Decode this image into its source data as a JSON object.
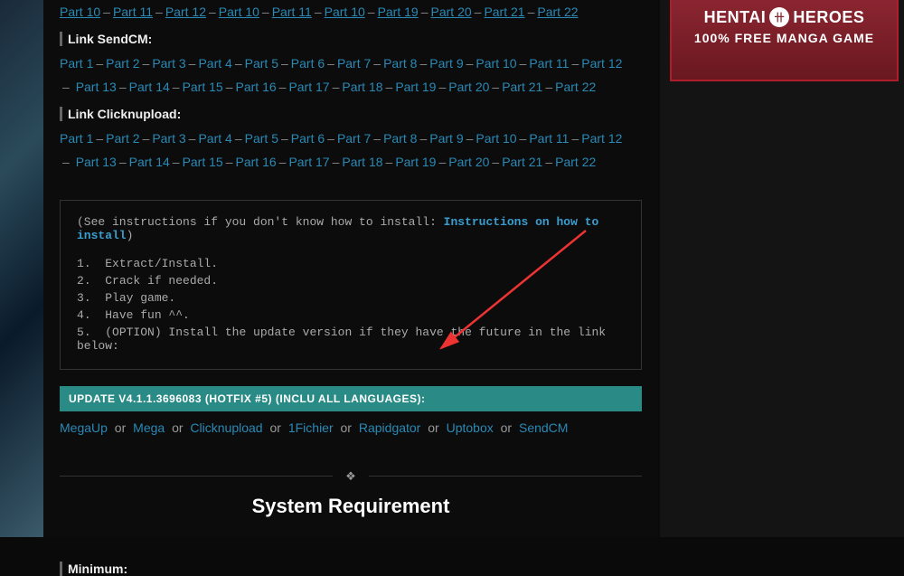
{
  "topParts": [
    "Part 10",
    "Part 11",
    "Part 12",
    "Part 10",
    "Part 11",
    "Part 10",
    "Part 19",
    "Part 20",
    "Part 21",
    "Part 22"
  ],
  "sections": [
    {
      "header": "Link SendCM:",
      "lines": [
        [
          "Part 1",
          "Part 2",
          "Part 3",
          "Part 4",
          "Part 5",
          "Part 6",
          "Part 7",
          "Part 8",
          "Part 9",
          "Part 10",
          "Part 11",
          "Part 12"
        ],
        [
          "Part 13",
          "Part 14",
          "Part 15",
          "Part 16",
          "Part 17",
          "Part 18",
          "Part 19",
          "Part 20",
          "Part 21",
          "Part 22"
        ]
      ]
    },
    {
      "header": "Link Clicknupload:",
      "lines": [
        [
          "Part 1",
          "Part 2",
          "Part 3",
          "Part 4",
          "Part 5",
          "Part 6",
          "Part 7",
          "Part 8",
          "Part 9",
          "Part 10",
          "Part 11",
          "Part 12"
        ],
        [
          "Part 13",
          "Part 14",
          "Part 15",
          "Part 16",
          "Part 17",
          "Part 18",
          "Part 19",
          "Part 20",
          "Part 21",
          "Part 22"
        ]
      ]
    }
  ],
  "instructions": {
    "intro_pre": "(See instructions if you don't know how to install: ",
    "intro_link": "Instructions on how to install",
    "intro_post": ")",
    "steps": [
      "Extract/Install.",
      "Crack if needed.",
      "Play game.",
      "Have fun ^^.",
      "(OPTION) Install the update version if they have the future in the link below:"
    ]
  },
  "update_label": "UPDATE V4.1.1.3696083 (HOTFIX #5) (INCLU ALL LANGUAGES):",
  "mirrors": [
    "MegaUp",
    "Mega",
    "Clicknupload",
    "1Fichier",
    "Rapidgator",
    "Uptobox",
    "SendCM"
  ],
  "or": "or",
  "sysreq_title": "System Requirement",
  "minimum": "Minimum:",
  "ad": {
    "brand1": "HENTAI",
    "brand2": "HEROES",
    "sub": "100% FREE MANGA GAME",
    "symbol": "卄"
  }
}
